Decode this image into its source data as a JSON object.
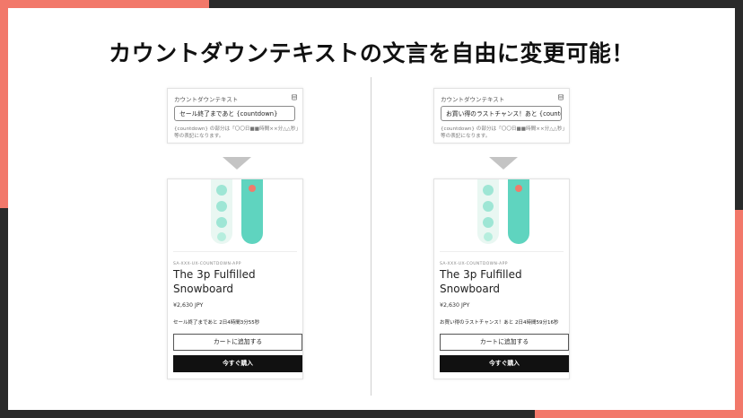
{
  "headline": "カウントダウンテキストの文言を自由に変更可能！",
  "colors": {
    "accent": "#f2786a",
    "dark": "#2a2a2a",
    "board_mint": "#5fd4bf",
    "board_pale": "#e9f7f2",
    "button_dark": "#111111"
  },
  "panels": [
    {
      "setting": {
        "title": "カウントダウンテキスト",
        "icon": "database-icon",
        "input_value": "セール終了まであと {countdown}",
        "help": "{countdown} の部分は「〇〇日■■時間××分△△秒」等の表記になります。"
      },
      "product": {
        "vendor": "SA-XXX-UX-COUNTDOWN-APP",
        "title": "The 3p Fulfilled Snowboard",
        "price": "¥2,630 JPY",
        "countdown": "セール終了まであと 2日4時間3分55秒",
        "add_to_cart": "カートに追加する",
        "buy_now": "今すぐ購入"
      }
    },
    {
      "setting": {
        "title": "カウントダウンテキスト",
        "icon": "database-icon",
        "input_value": "お買い得のラストチャンス！あと {countdown}",
        "help": "{countdown} の部分は「〇〇日■■時間××分△△秒」等の表記になります。"
      },
      "product": {
        "vendor": "SA-XXX-UX-COUNTDOWN-APP",
        "title": "The 3p Fulfilled Snowboard",
        "price": "¥2,630 JPY",
        "countdown": "お買い得のラストチャンス！あと 2日4時間59分16秒",
        "add_to_cart": "カートに追加する",
        "buy_now": "今すぐ購入"
      }
    }
  ]
}
